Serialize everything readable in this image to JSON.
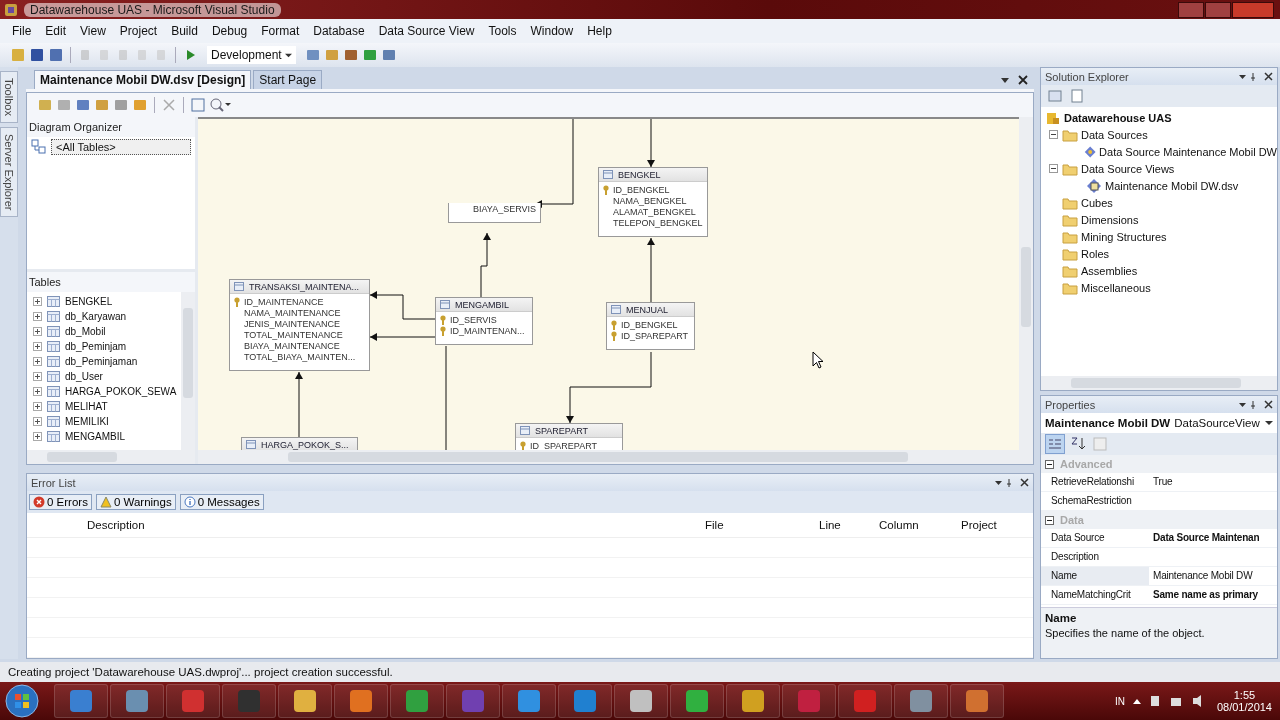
{
  "window": {
    "title": "Datawarehouse UAS - Microsoft Visual Studio"
  },
  "menu": [
    "File",
    "Edit",
    "View",
    "Project",
    "Build",
    "Debug",
    "Format",
    "Database",
    "Data Source View",
    "Tools",
    "Window",
    "Help"
  ],
  "toolbar": {
    "configuration": "Development"
  },
  "side_tabs": [
    "Toolbox",
    "Server Explorer"
  ],
  "document_tabs": [
    {
      "label": "Maintenance Mobil DW.dsv [Design]",
      "selected": true
    },
    {
      "label": "Start Page",
      "selected": false
    }
  ],
  "diagram_organizer": {
    "title": "Diagram Organizer",
    "items": [
      "<All Tables>"
    ]
  },
  "tables_panel": {
    "title": "Tables",
    "items": [
      "BENGKEL",
      "db_Karyawan",
      "db_Mobil",
      "db_Peminjam",
      "db_Peminjaman",
      "db_User",
      "HARGA_POKOK_SEWA",
      "MELIHAT",
      "MEMILIKI",
      "MENGAMBIL"
    ]
  },
  "diagram": {
    "tables": [
      {
        "name": "BENGKEL",
        "columns": [
          {
            "name": "ID_BENGKEL",
            "key": true
          },
          {
            "name": "NAMA_BENGKEL",
            "key": false
          },
          {
            "name": "ALAMAT_BENGKEL",
            "key": false
          },
          {
            "name": "TELEPON_BENGKEL",
            "key": false
          }
        ]
      },
      {
        "columns": [
          {
            "name": "BIAYA_SERVIS",
            "key": false
          }
        ]
      },
      {
        "name": "TRANSAKSI_MAINTENA...",
        "columns": [
          {
            "name": "ID_MAINTENANCE",
            "key": true
          },
          {
            "name": "NAMA_MAINTENANCE",
            "key": false
          },
          {
            "name": "JENIS_MAINTENANCE",
            "key": false
          },
          {
            "name": "TOTAL_MAINTENANCE",
            "key": false
          },
          {
            "name": "BIAYA_MAINTENANCE",
            "key": false
          },
          {
            "name": "TOTAL_BIAYA_MAINTEN...",
            "key": false
          }
        ]
      },
      {
        "name": "MENGAMBIL",
        "columns": [
          {
            "name": "ID_SERVIS",
            "key": true
          },
          {
            "name": "ID_MAINTENAN...",
            "key": true
          }
        ]
      },
      {
        "name": "MENJUAL",
        "columns": [
          {
            "name": "ID_BENGKEL",
            "key": true
          },
          {
            "name": "ID_SPAREPART",
            "key": true
          }
        ]
      },
      {
        "name": "HARGA_POKOK_S..."
      },
      {
        "name": "SPAREPART",
        "columns": [
          {
            "name": "ID_SPAREPART",
            "key": true
          }
        ]
      }
    ]
  },
  "solution_explorer": {
    "title": "Solution Explorer",
    "tree": [
      {
        "label": "Datawarehouse UAS",
        "kind": "project",
        "children": [
          {
            "label": "Data Sources",
            "kind": "folder",
            "expanded": true,
            "children": [
              {
                "label": "Data Source Maintenance Mobil DW",
                "kind": "datasource"
              }
            ]
          },
          {
            "label": "Data Source Views",
            "kind": "folder",
            "expanded": true,
            "children": [
              {
                "label": "Maintenance Mobil DW.dsv",
                "kind": "dsv"
              }
            ]
          },
          {
            "label": "Cubes",
            "kind": "folder"
          },
          {
            "label": "Dimensions",
            "kind": "folder"
          },
          {
            "label": "Mining Structures",
            "kind": "folder"
          },
          {
            "label": "Roles",
            "kind": "folder"
          },
          {
            "label": "Assemblies",
            "kind": "folder"
          },
          {
            "label": "Miscellaneous",
            "kind": "folder"
          }
        ]
      }
    ]
  },
  "properties": {
    "title": "Properties",
    "object_name": "Maintenance Mobil DW",
    "object_type": "DataSourceView",
    "categories": [
      {
        "name": "Advanced",
        "expanded": true,
        "rows": [
          {
            "name": "RetrieveRelationshi",
            "value": "True",
            "modified": false,
            "selected": false
          },
          {
            "name": "SchemaRestriction",
            "selected": false
          }
        ]
      },
      {
        "name": "Data",
        "expanded": true,
        "rows": [
          {
            "name": "Data Source",
            "value": "Data Source Maintenan",
            "modified": true,
            "selected": false
          },
          {
            "name": "Description",
            "selected": false
          },
          {
            "name": "Name",
            "value": "Maintenance Mobil DW",
            "modified": false,
            "selected": true
          },
          {
            "name": "NameMatchingCrit",
            "value": "Same name as primary",
            "modified": true,
            "selected": false
          }
        ]
      }
    ],
    "description": {
      "title": "Name",
      "text": "Specifies the name of the object."
    }
  },
  "error_list": {
    "title": "Error List",
    "filters": [
      {
        "kind": "error",
        "label": "0 Errors"
      },
      {
        "kind": "warning",
        "label": "0 Warnings"
      },
      {
        "kind": "message",
        "label": "0 Messages"
      }
    ],
    "columns": [
      "Description",
      "File",
      "Line",
      "Column",
      "Project"
    ]
  },
  "status_bar": {
    "text": "Creating project 'Datawarehouse UAS.dwproj'... project creation successful."
  },
  "taskbar": {
    "language": "IN",
    "time": "1:55",
    "date": "08/01/2014"
  }
}
